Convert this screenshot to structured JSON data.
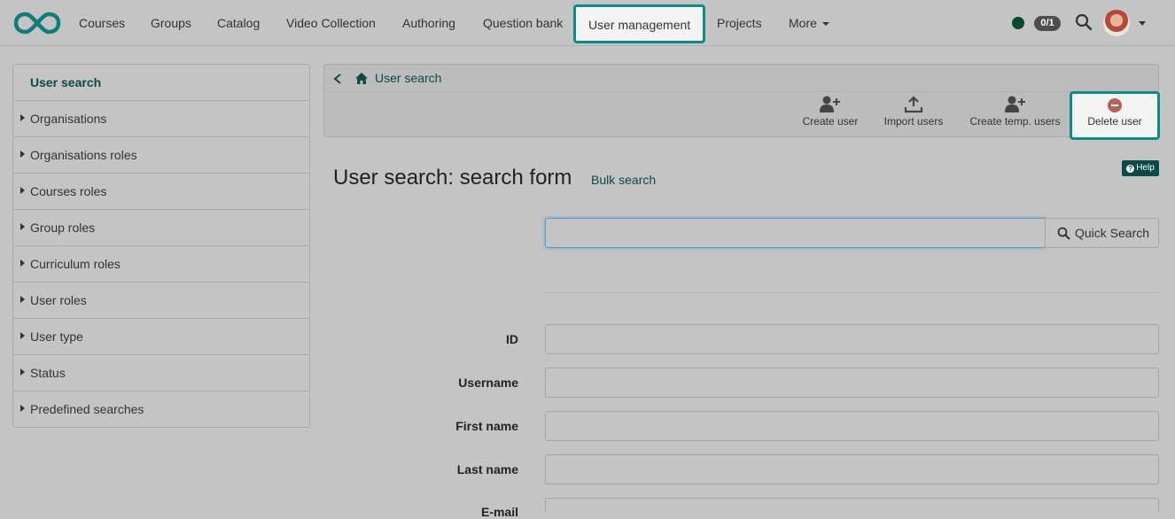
{
  "nav": {
    "items": [
      "Courses",
      "Groups",
      "Catalog",
      "Video Collection",
      "Authoring",
      "Question bank",
      "User management",
      "Projects",
      "More"
    ],
    "badge": "0/1"
  },
  "sidebar": {
    "items": [
      {
        "label": "User search"
      },
      {
        "label": "Organisations"
      },
      {
        "label": "Organisations roles"
      },
      {
        "label": "Courses roles"
      },
      {
        "label": "Group roles"
      },
      {
        "label": "Curriculum roles"
      },
      {
        "label": "User roles"
      },
      {
        "label": "User type"
      },
      {
        "label": "Status"
      },
      {
        "label": "Predefined searches"
      }
    ]
  },
  "breadcrumb": {
    "label": "User search"
  },
  "toolbar": {
    "create_user": "Create user",
    "import_users": "Import users",
    "create_temp_users": "Create temp. users",
    "delete_user": "Delete user"
  },
  "main": {
    "help": "Help",
    "title": "User search: search form",
    "bulk_search": "Bulk search",
    "quick_search": "Quick Search",
    "quick_value": "",
    "fields": [
      "ID",
      "Username",
      "First name",
      "Last name",
      "E-mail"
    ]
  },
  "colors": {
    "accent": "#0f8b86",
    "brand": "#0a4a47",
    "status": "#0a4a2c"
  }
}
